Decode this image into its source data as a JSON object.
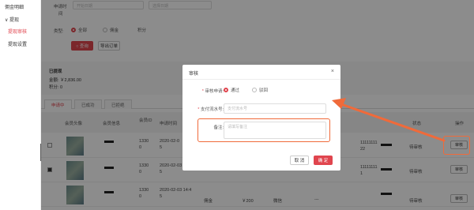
{
  "sidebar": {
    "items": [
      {
        "label": "佣金明细"
      },
      {
        "label": "∨ 提现"
      },
      {
        "label": "提现审核"
      },
      {
        "label": "提现设置"
      }
    ]
  },
  "filters": {
    "date_label": "申请时",
    "date_value": "间",
    "start_placeholder": "开始日期",
    "end_placeholder": "选择日期",
    "type_label": "类型:",
    "type_options": [
      {
        "label": "全部"
      },
      {
        "label": "佣金"
      },
      {
        "label": "积分"
      }
    ],
    "search_label": "○ 查询",
    "export_label": "导出订单"
  },
  "summary": {
    "title": "已提现",
    "amount": "金额: ￥2,836.00",
    "points": "积分: 0"
  },
  "tabs": [
    {
      "label": "申请中"
    },
    {
      "label": "已成功"
    },
    {
      "label": "已拒绝"
    }
  ],
  "table": {
    "headers": [
      "会员头像",
      "会员信息",
      "会员ID",
      "申请时间",
      "",
      "",
      "",
      "",
      "",
      "状态",
      "操作"
    ],
    "rows": [
      {
        "id": "1330",
        "id2": "0",
        "time": "2020-02-0",
        "time2": "5",
        "account": "11111111",
        "account2": "22",
        "status": "待审核",
        "action": "审核"
      },
      {
        "id": "1330",
        "id2": "0",
        "time": "2020-02-03",
        "time2": "5",
        "account": "11111111",
        "account2": "1",
        "status": "待审核",
        "action": "审核"
      },
      {
        "id": "1330",
        "id2": "0",
        "time": "2020-02-03 14:4",
        "time2": "5",
        "type": "佣金",
        "amount": "￥200",
        "channel": "微信",
        "account": "---",
        "status": "待审核",
        "action": "审核"
      }
    ]
  },
  "modal": {
    "title": "审核",
    "close": "×",
    "result_label": "审核申请:",
    "options": [
      {
        "label": "通过"
      },
      {
        "label": "驳回"
      }
    ],
    "serial_label": "支付流水号:",
    "serial_placeholder": "支付流水号",
    "remark_label": "备注:",
    "remark_placeholder": "请填写备注",
    "cancel": "取 消",
    "confirm": "确 定"
  },
  "colors": {
    "accent": "#e0454e",
    "highlight": "#f06a3a"
  }
}
